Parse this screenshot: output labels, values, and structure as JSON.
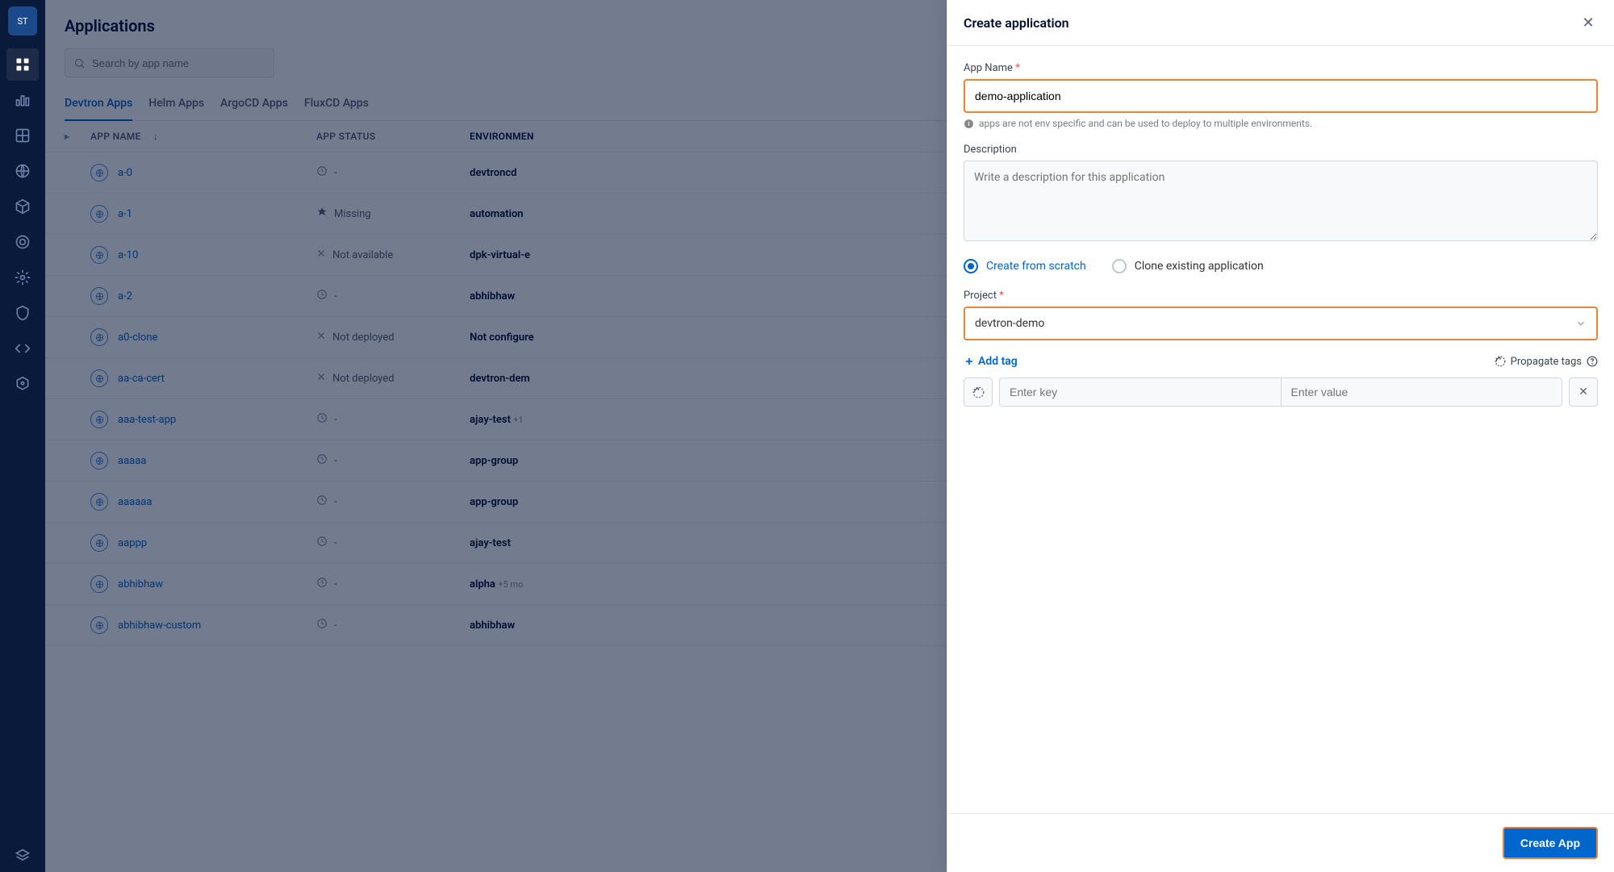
{
  "page": {
    "title": "Applications",
    "search_placeholder": "Search by app name"
  },
  "tabs": [
    {
      "label": "Devtron Apps",
      "active": true
    },
    {
      "label": "Helm Apps",
      "active": false
    },
    {
      "label": "ArgoCD Apps",
      "active": false
    },
    {
      "label": "FluxCD Apps",
      "active": false
    }
  ],
  "table": {
    "headers": {
      "name": "APP NAME",
      "status": "APP STATUS",
      "env": "ENVIRONMEN"
    },
    "rows": [
      {
        "name": "a-0",
        "status": "-",
        "status_icon": "clock",
        "env": "devtroncd",
        "env_extra": ""
      },
      {
        "name": "a-1",
        "status": "Missing",
        "status_icon": "missing",
        "env": "automation",
        "env_extra": ""
      },
      {
        "name": "a-10",
        "status": "Not available",
        "status_icon": "x",
        "env": "dpk-virtual-e",
        "env_extra": ""
      },
      {
        "name": "a-2",
        "status": "-",
        "status_icon": "clock",
        "env": "abhibhaw",
        "env_extra": ""
      },
      {
        "name": "a0-clone",
        "status": "Not deployed",
        "status_icon": "x",
        "env": "Not configure",
        "env_extra": ""
      },
      {
        "name": "aa-ca-cert",
        "status": "Not deployed",
        "status_icon": "x",
        "env": "devtron-dem",
        "env_extra": ""
      },
      {
        "name": "aaa-test-app",
        "status": "-",
        "status_icon": "clock",
        "env": "ajay-test",
        "env_extra": "+1"
      },
      {
        "name": "aaaaa",
        "status": "-",
        "status_icon": "clock",
        "env": "app-group",
        "env_extra": ""
      },
      {
        "name": "aaaaaa",
        "status": "-",
        "status_icon": "clock",
        "env": "app-group",
        "env_extra": ""
      },
      {
        "name": "aappp",
        "status": "-",
        "status_icon": "clock",
        "env": "ajay-test",
        "env_extra": ""
      },
      {
        "name": "abhibhaw",
        "status": "-",
        "status_icon": "clock",
        "env": "alpha",
        "env_extra": "+5 mo"
      },
      {
        "name": "abhibhaw-custom",
        "status": "-",
        "status_icon": "clock",
        "env": "abhibhaw",
        "env_extra": ""
      }
    ]
  },
  "drawer": {
    "title": "Create application",
    "form": {
      "app_name_label": "App Name",
      "app_name_value": "demo-application",
      "app_name_hint": "apps are not env specific and can be used to deploy to multiple environments.",
      "description_label": "Description",
      "description_placeholder": "Write a description for this application",
      "radio_scratch": "Create from scratch",
      "radio_clone": "Clone existing application",
      "project_label": "Project",
      "project_value": "devtron-demo",
      "add_tag": "Add tag",
      "propagate_tags": "Propagate tags",
      "tag_key_placeholder": "Enter key",
      "tag_value_placeholder": "Enter value"
    },
    "footer": {
      "create_button": "Create App"
    }
  }
}
